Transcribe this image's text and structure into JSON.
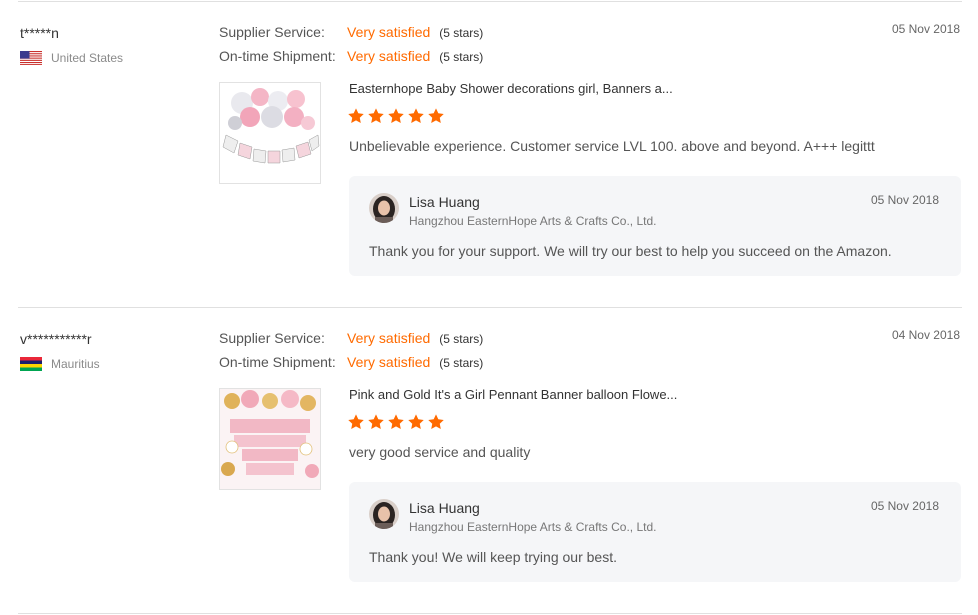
{
  "reviews": [
    {
      "buyer": "t*****n",
      "country": "United States",
      "flag": "us-flag",
      "supplier_label": "Supplier Service:",
      "supplier_value": "Very satisfied",
      "supplier_stars": "(5 stars)",
      "shipment_label": "On-time Shipment:",
      "shipment_value": "Very satisfied",
      "shipment_stars": "(5 stars)",
      "date": "05 Nov 2018",
      "product_title": "Easternhope Baby Shower decorations girl, Banners a...",
      "product_image": "baby-shower-its-a-girl-decor-image",
      "rating": 5,
      "text": "Unbelievable experience. Customer service LVL 100. above and beyond. A+++ legittt",
      "reply": {
        "name": "Lisa Huang",
        "company": "Hangzhou EasternHope Arts & Crafts Co., Ltd.",
        "date": "05 Nov 2018",
        "text": "Thank you for your support. We will try our best to help you succeed on the Amazon."
      }
    },
    {
      "buyer": "v***********r",
      "country": "Mauritius",
      "flag": "mauritius-flag",
      "supplier_label": "Supplier Service:",
      "supplier_value": "Very satisfied",
      "supplier_stars": "(5 stars)",
      "shipment_label": "On-time Shipment:",
      "shipment_value": "Very satisfied",
      "shipment_stars": "(5 stars)",
      "date": "04 Nov 2018",
      "product_title": "Pink and Gold It's a Girl Pennant Banner balloon Flowe...",
      "product_image": "pink-gold-baby-shower-banner-image",
      "rating": 5,
      "text": "very good service and quality",
      "reply": {
        "name": "Lisa Huang",
        "company": "Hangzhou EasternHope Arts & Crafts Co., Ltd.",
        "date": "05 Nov 2018",
        "text": "Thank you! We will keep trying our best."
      }
    }
  ],
  "colors": {
    "accent": "#ff6a00",
    "star": "#ff6a00",
    "reply_bg": "#f5f6f8"
  }
}
